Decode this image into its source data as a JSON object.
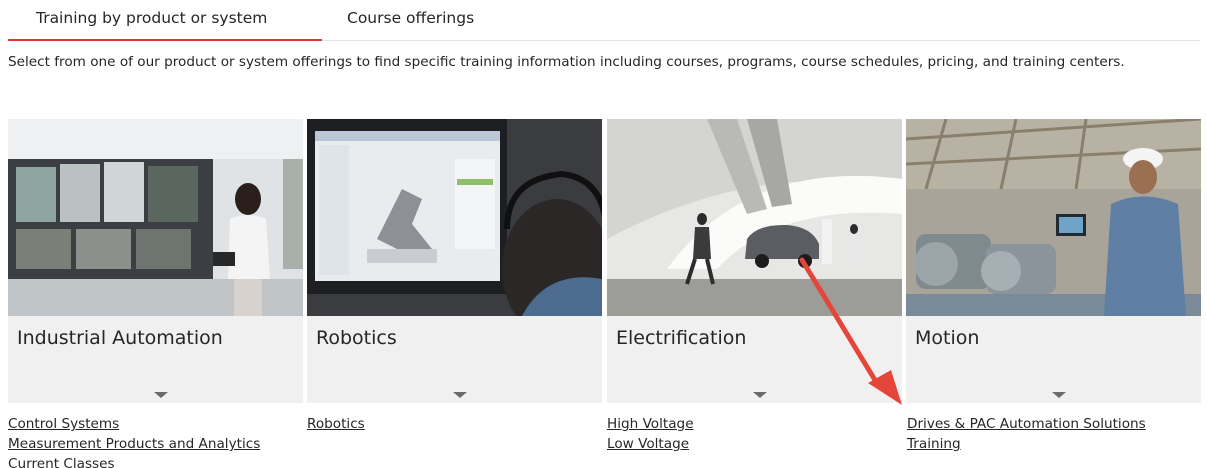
{
  "tabs": [
    {
      "label": "Training by product or system",
      "active": true
    },
    {
      "label": "Course offerings",
      "active": false
    }
  ],
  "intro": "Select from one of our product or system offerings to find specific training information including courses, programs, course schedules, pricing, and training centers.",
  "cards": [
    {
      "title": "Industrial Automation",
      "links": [
        {
          "label": "Control Systems"
        },
        {
          "label": "Measurement Products and Analytics"
        }
      ],
      "plain_text": "Current Classes"
    },
    {
      "title": "Robotics",
      "links": [
        {
          "label": "Robotics"
        }
      ]
    },
    {
      "title": "Electrification",
      "links": [
        {
          "label": "High Voltage"
        },
        {
          "label": "Low Voltage"
        }
      ]
    },
    {
      "title": "Motion",
      "links": [
        {
          "label": "Drives & PAC Automation Solutions"
        },
        {
          "label": "Training"
        }
      ]
    }
  ],
  "colors": {
    "accent": "#e8352c",
    "annotation_arrow": "#e5463a",
    "card_bg": "#f0f0f0",
    "text": "#262626"
  }
}
